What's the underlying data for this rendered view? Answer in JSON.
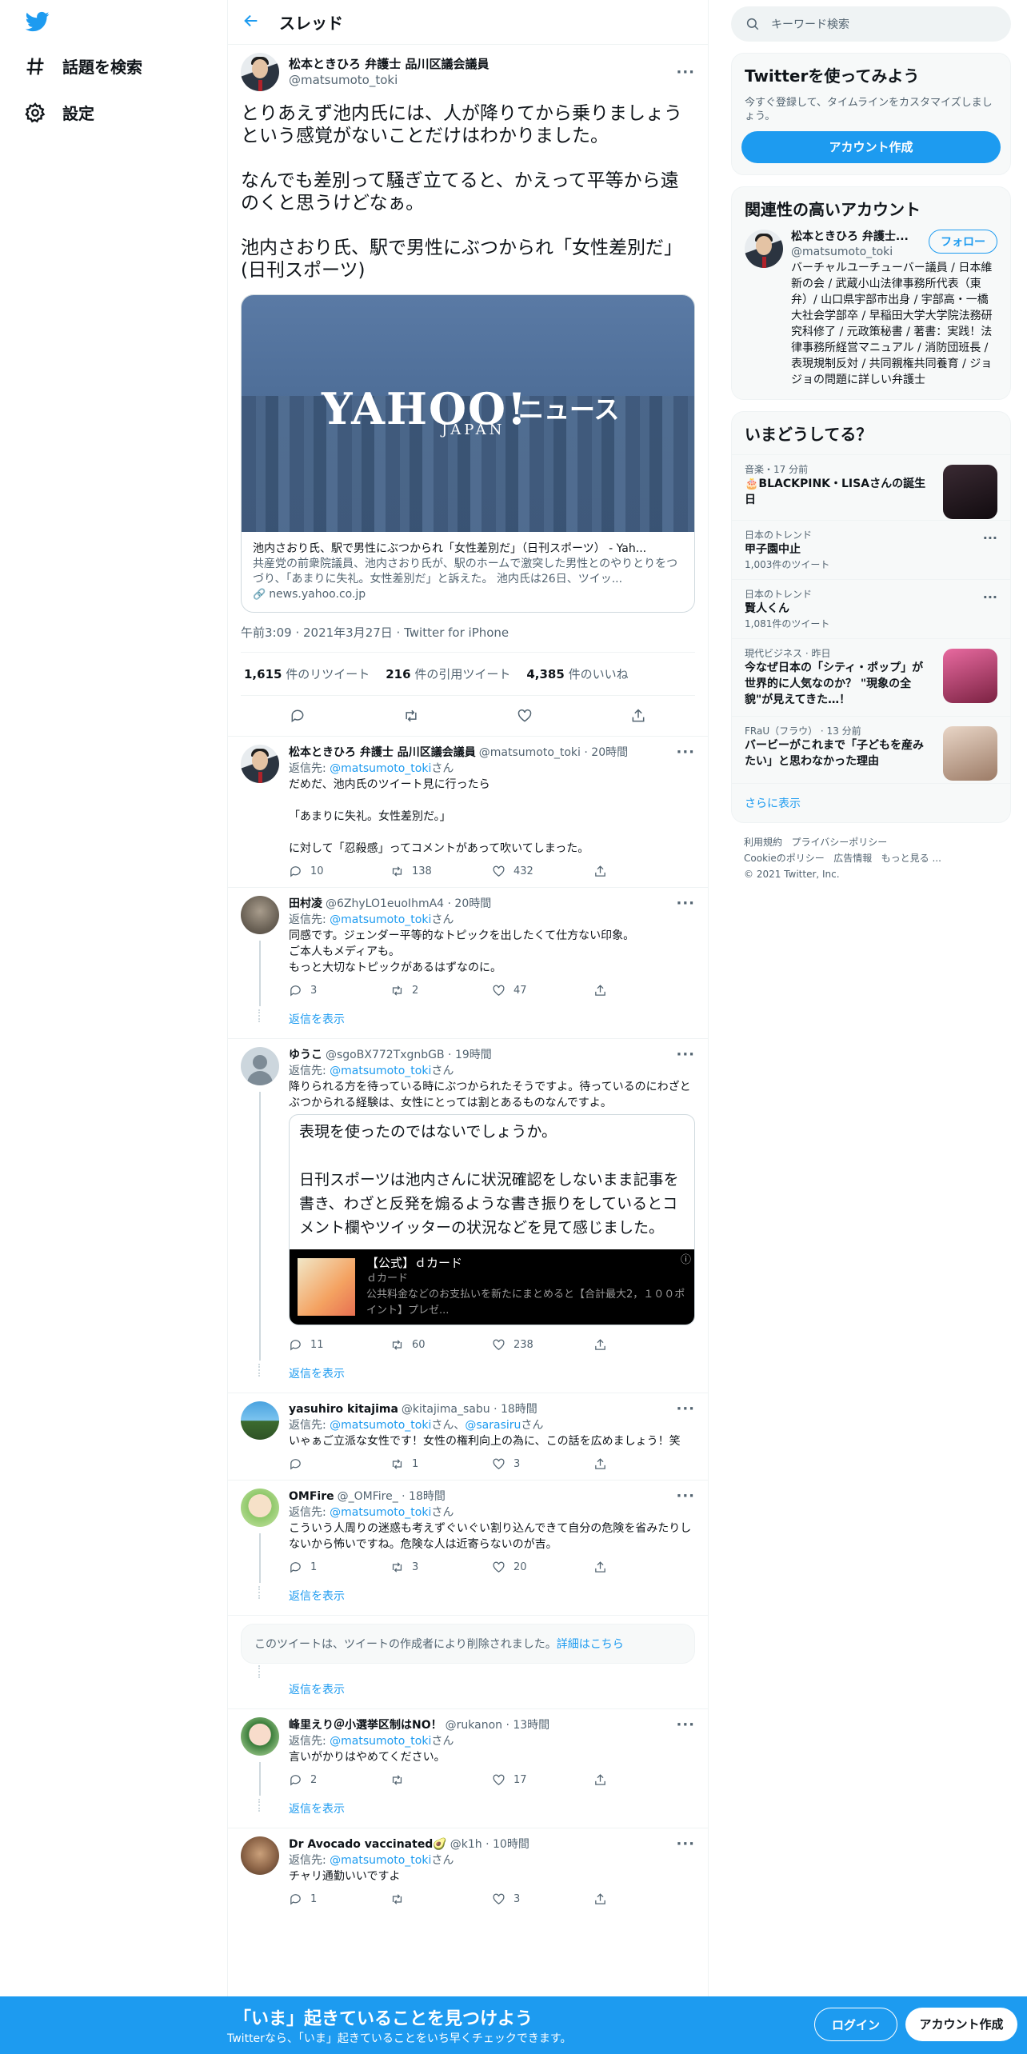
{
  "nav": {
    "explore": "話題を検索",
    "settings": "設定"
  },
  "header": {
    "title": "スレッド"
  },
  "main_tweet": {
    "name": "松本ときひろ 弁護士 品川区議会議員",
    "handle": "@matsumoto_toki",
    "text": "とりあえず池内氏には、人が降りてから乗りましょうという感覚がないことだけはわかりました。\n\nなんでも差別って騒ぎ立てると、かえって平等から遠のくと思うけどなぁ。\n\n池内さおり氏、駅で男性にぶつかられ「女性差別だ」(日刊スポーツ)",
    "card": {
      "brand": "YAHOO!",
      "brand_sub": "JAPAN",
      "brand_jp": "ニュース",
      "title": "池内さおり氏、駅で男性にぶつかられ「女性差別だ」（日刊スポーツ） - Yah...",
      "desc": "共産党の前衆院議員、池内さおり氏が、駅のホームで激突した男性とのやりとりをつづり、「あまりに失礼。女性差別だ」と訴えた。 池内氏は26日、ツイッ...",
      "domain": "news.yahoo.co.jp"
    },
    "meta": "午前3:09 · 2021年3月27日 · Twitter for iPhone",
    "stats": {
      "retweets": "1,615",
      "retweets_label": "件のリツイート",
      "quotes": "216",
      "quotes_label": "件の引用ツイート",
      "likes": "4,385",
      "likes_label": "件のいいね"
    }
  },
  "replies": [
    {
      "name": "松本ときひろ 弁護士 品川区議会議員",
      "handle": "@matsumoto_toki · 20時間",
      "reply_prefix": "返信先: ",
      "reply_to": "@matsumoto_toki",
      "reply_suffix": "さん",
      "text": "だめだ、池内氏のツイート見に行ったら\n\n「あまりに失礼。女性差別だ。」\n\nに対して「忍殺感」ってコメントがあって吹いてしまった。",
      "replies": "10",
      "retweets": "138",
      "likes": "432"
    },
    {
      "name": "田村凌",
      "handle": "@6ZhyLO1euoIhmA4 · 20時間",
      "reply_prefix": "返信先: ",
      "reply_to": "@matsumoto_toki",
      "reply_suffix": "さん",
      "text": "同感です。ジェンダー平等的なトピックを出したくて仕方ない印象。\nご本人もメディアも。\nもっと大切なトピックがあるはずなのに。",
      "replies": "3",
      "retweets": "2",
      "likes": "47",
      "show_more": "返信を表示"
    },
    {
      "name": "ゆうこ",
      "handle": "@sgoBX772TxgnbGB · 19時間",
      "reply_prefix": "返信先: ",
      "reply_to": "@matsumoto_toki",
      "reply_suffix": "さん",
      "text": "降りられる方を待っている時にぶつかられたそうですよ。待っているのにわざとぶつかられる経験は、女性にとっては割とあるものなんですよ。",
      "quote_text": "表現を使ったのではないでしょうか。\n\n日刊スポーツは池内さんに状況確認をしないまま記事を書き、わざと反発を煽るような書き振りをしているとコメント欄やツイッターの状況などを見て感じました。",
      "ad_title": "【公式】ｄカード",
      "ad_source": "ｄカード",
      "ad_desc": "公共料金などのお支払いを新たにまとめると【合計最大2，１００ポイント】プレゼ...",
      "replies": "11",
      "retweets": "60",
      "likes": "238",
      "show_more": "返信を表示"
    },
    {
      "name": "yasuhiro kitajima",
      "handle": "@kitajima_sabu · 18時間",
      "reply_prefix": "返信先: ",
      "reply_to": "@matsumoto_toki",
      "reply_mid": "さん、",
      "reply_to2": "@sarasiru",
      "reply_suffix": "さん",
      "text": "いゃぁご立派な女性です！女性の権利向上の為に、この話を広めましょう！笑",
      "replies": "",
      "retweets": "1",
      "likes": "3"
    },
    {
      "name": "OMFire",
      "handle": "@_OMFire_ · 18時間",
      "reply_prefix": "返信先: ",
      "reply_to": "@matsumoto_toki",
      "reply_suffix": "さん",
      "text": "こういう人周りの迷惑も考えずぐいぐい割り込んできて自分の危険を省みたりしないから怖いですね。危険な人は近寄らないのが吉。",
      "replies": "1",
      "retweets": "3",
      "likes": "20",
      "show_more": "返信を表示"
    },
    {
      "deleted_text": "このツイートは、ツイートの作成者により削除されました。",
      "deleted_link": "詳細はこちら",
      "show_more": "返信を表示"
    },
    {
      "name": "峰里えり＠小選挙区制はNO！",
      "handle": "@rukanon · 13時間",
      "reply_prefix": "返信先: ",
      "reply_to": "@matsumoto_toki",
      "reply_suffix": "さん",
      "text": "言いがかりはやめてください。",
      "replies": "2",
      "retweets": "",
      "likes": "17",
      "show_more": "返信を表示"
    },
    {
      "name": "Dr Avocado vaccinated🥑",
      "handle": "@k1h · 10時間",
      "reply_prefix": "返信先: ",
      "reply_to": "@matsumoto_toki",
      "reply_suffix": "さん",
      "text": "チャリ通勤いいですよ",
      "replies": "1",
      "retweets": "",
      "likes": "3"
    }
  ],
  "sidebar": {
    "search_placeholder": "キーワード検索",
    "signup_panel": {
      "title": "Twitterを使ってみよう",
      "sub": "今すぐ登録して、タイムラインをカスタマイズしましょう。",
      "button": "アカウント作成"
    },
    "related": {
      "title": "関連性の高いアカウント",
      "name": "松本ときひろ 弁護士...",
      "handle": "@matsumoto_toki",
      "follow": "フォロー",
      "desc": "バーチャルユーチューバー議員 / 日本維新の会 / 武蔵小山法律事務所代表（東弁）/ 山口県宇部市出身 / 宇部高・一橋大社会学部卒 / 早稲田大学大学院法務研究科修了 / 元政策秘書 / 著書：実践！法律事務所経営マニュアル / 消防団班長 / 表現規制反対 / 共同親権共同養育 / ジョジョの問題に詳しい弁護士"
    },
    "trends": {
      "title": "いまどうしてる？",
      "items": [
        {
          "cat": "音楽・17 分前",
          "title": "🎂BLACKPINK・LISAさんの誕生日",
          "count": "",
          "color": "#2a1f26"
        },
        {
          "cat": "日本のトレンド",
          "title": "甲子園中止",
          "count": "1,003件のツイート"
        },
        {
          "cat": "日本のトレンド",
          "title": "賢人くん",
          "count": "1,081件のツイート"
        },
        {
          "cat": "現代ビジネス · 昨日",
          "title": "今なぜ日本の「シティ・ポップ」が世界的に人気なのか？ \"現象の全貌\"が見えてきた…！",
          "count": "",
          "color": "#c23b6c"
        },
        {
          "cat": "FRaU（フラウ） · 13 分前",
          "title": "バービーがこれまで「子どもを産みたい」と思わなかった理由",
          "count": "",
          "color": "#d6b9a3"
        }
      ],
      "show_more": "さらに表示"
    },
    "footer": {
      "links": [
        "利用規約",
        "プライバシーポリシー",
        "Cookieのポリシー",
        "広告情報",
        "もっと見る ..."
      ],
      "copyright": "© 2021 Twitter, Inc."
    }
  },
  "bottom": {
    "headline": "「いま」起きていることを見つけよう",
    "sub": "Twitterなら、「いま」起きていることをいち早くチェックできます。",
    "login": "ログイン",
    "signup": "アカウント作成"
  },
  "colors": {
    "accent": "#1d9bf0",
    "text": "#0f1419",
    "muted": "#536471"
  }
}
